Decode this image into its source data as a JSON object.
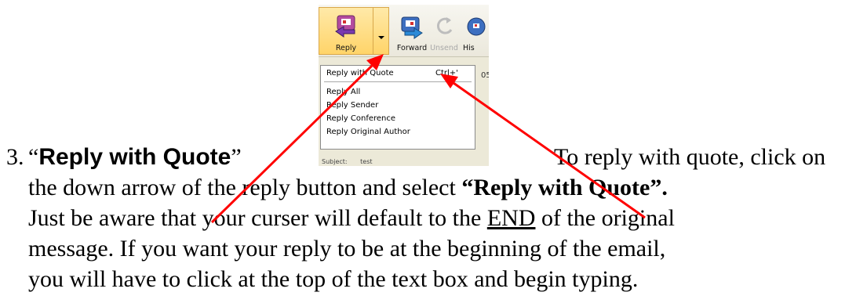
{
  "toolbar": {
    "reply_label": "Reply",
    "forward_label": "Forward",
    "unsend_label": "Unsend",
    "history_label": "His"
  },
  "menu": {
    "reply_with_quote": "Reply with Quote",
    "reply_with_quote_shortcut": "Ctrl+'",
    "reply_all": "Reply All",
    "reply_sender": "Reply Sender",
    "reply_conference": "Reply Conference",
    "reply_original_author": "Reply Original Author"
  },
  "background_fragments": {
    "side_text": "05",
    "subject_label": "Subject:",
    "subject_value": "test"
  },
  "instruction": {
    "number": "3.",
    "open_quote": "“",
    "title": "Reply with Quote",
    "close_quote": "”",
    "line1_tail": "To reply with quote, click on",
    "line2_pre": "the down arrow of the reply button and select ",
    "line2_bold": "“Reply with Quote”.",
    "line3_pre": "Just be aware that your curser will default to the ",
    "line3_underline": "END",
    "line3_post": " of the original",
    "line4": "message.  If you want your reply to be at the beginning of the email,",
    "line5": "you will have to click at the top of the text box and begin typing."
  },
  "colors": {
    "arrow": "#ff0000",
    "reply_button_highlight": "#ffd469",
    "toolbar_background": "#ece9d8"
  }
}
